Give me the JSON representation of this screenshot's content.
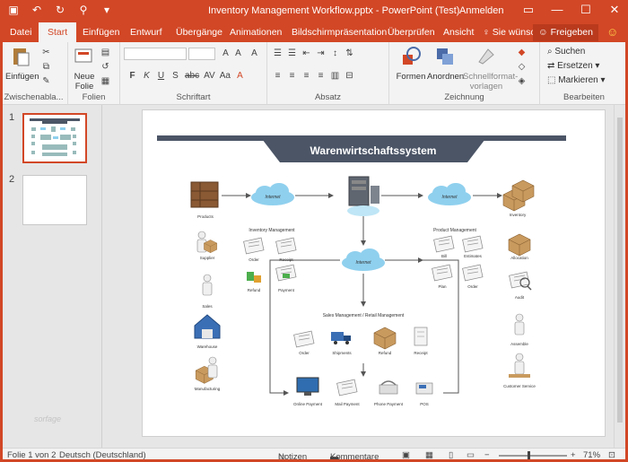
{
  "window": {
    "title": "Inventory Management Workflow.pptx - PowerPoint (Test)",
    "signin": "Anmelden",
    "controls": [
      "▭",
      "—",
      "☐",
      "✕"
    ]
  },
  "tabs": [
    {
      "label": "Datei",
      "active": false
    },
    {
      "label": "Start",
      "active": true
    },
    {
      "label": "Einfügen",
      "active": false
    },
    {
      "label": "Entwurf",
      "active": false
    },
    {
      "label": "Übergänge",
      "active": false
    },
    {
      "label": "Animationen",
      "active": false
    },
    {
      "label": "Bildschirmpräsentation",
      "active": false
    },
    {
      "label": "Überprüfen",
      "active": false
    },
    {
      "label": "Ansicht",
      "active": false
    }
  ],
  "tell_me": "Sie wünsc",
  "share": "Freigeben",
  "ribbon": {
    "clipboard": {
      "paste": "Einfügen",
      "label": "Zwischenabla..."
    },
    "slides": {
      "new_slide_line1": "Neue",
      "new_slide_line2": "Folie",
      "label": "Folien"
    },
    "font": {
      "label": "Schriftart",
      "controls": [
        "F",
        "K",
        "U",
        "S",
        "abc",
        "AV",
        "Aa",
        "A"
      ]
    },
    "paragraph": {
      "label": "Absatz"
    },
    "drawing": {
      "shapes": "Formen",
      "arrange": "Anordnen",
      "quick_styles_line1": "Schnellformat-",
      "quick_styles_line2": "vorlagen",
      "label": "Zeichnung"
    },
    "editing": {
      "find": "Suchen",
      "replace": "Ersetzen",
      "select": "Markieren",
      "label": "Bearbeiten"
    }
  },
  "slides_panel": [
    {
      "number": "1"
    },
    {
      "number": "2"
    }
  ],
  "diagram": {
    "title": "Warenwirtschaftssystem",
    "section_inventory": "Inventory Management",
    "section_product": "Product Management",
    "section_sales": "Sales Management / Retail Management",
    "clouds": [
      "Internet",
      "Internet",
      "Internet",
      "Internet"
    ],
    "items": {
      "products": "Products",
      "supplier": "Supplier",
      "sales": "Sales",
      "warehouse": "Warehouse",
      "manufacturing": "Manufacturing",
      "order": "Order",
      "receipt": "Receipt",
      "refund": "Refund",
      "payment": "Payment",
      "inventory": "Inventory",
      "bill": "Bill",
      "estimates": "Estimates",
      "allocation": "Allocation",
      "plan": "Plan",
      "product_order": "Order",
      "audit": "Audit",
      "assemble": "Assemble",
      "customer_service": "Customer Service",
      "sales_order": "Order",
      "shipments": "Shipments",
      "sales_refund": "Refund",
      "sales_receipt": "Receipt",
      "online_payment": "Online Payment",
      "mail_payment": "Mail Payment",
      "phone_payment": "Phone Payment",
      "pos": "POS"
    }
  },
  "watermark": "sorfage",
  "status": {
    "slide_info": "Folie 1 von 2",
    "language": "Deutsch (Deutschland)",
    "notes": "Notizen",
    "comments": "Kommentare",
    "zoom": "71%"
  },
  "colors": {
    "accent": "#d24726",
    "banner": "#4b5566",
    "cloud": "#8fd0ee"
  }
}
